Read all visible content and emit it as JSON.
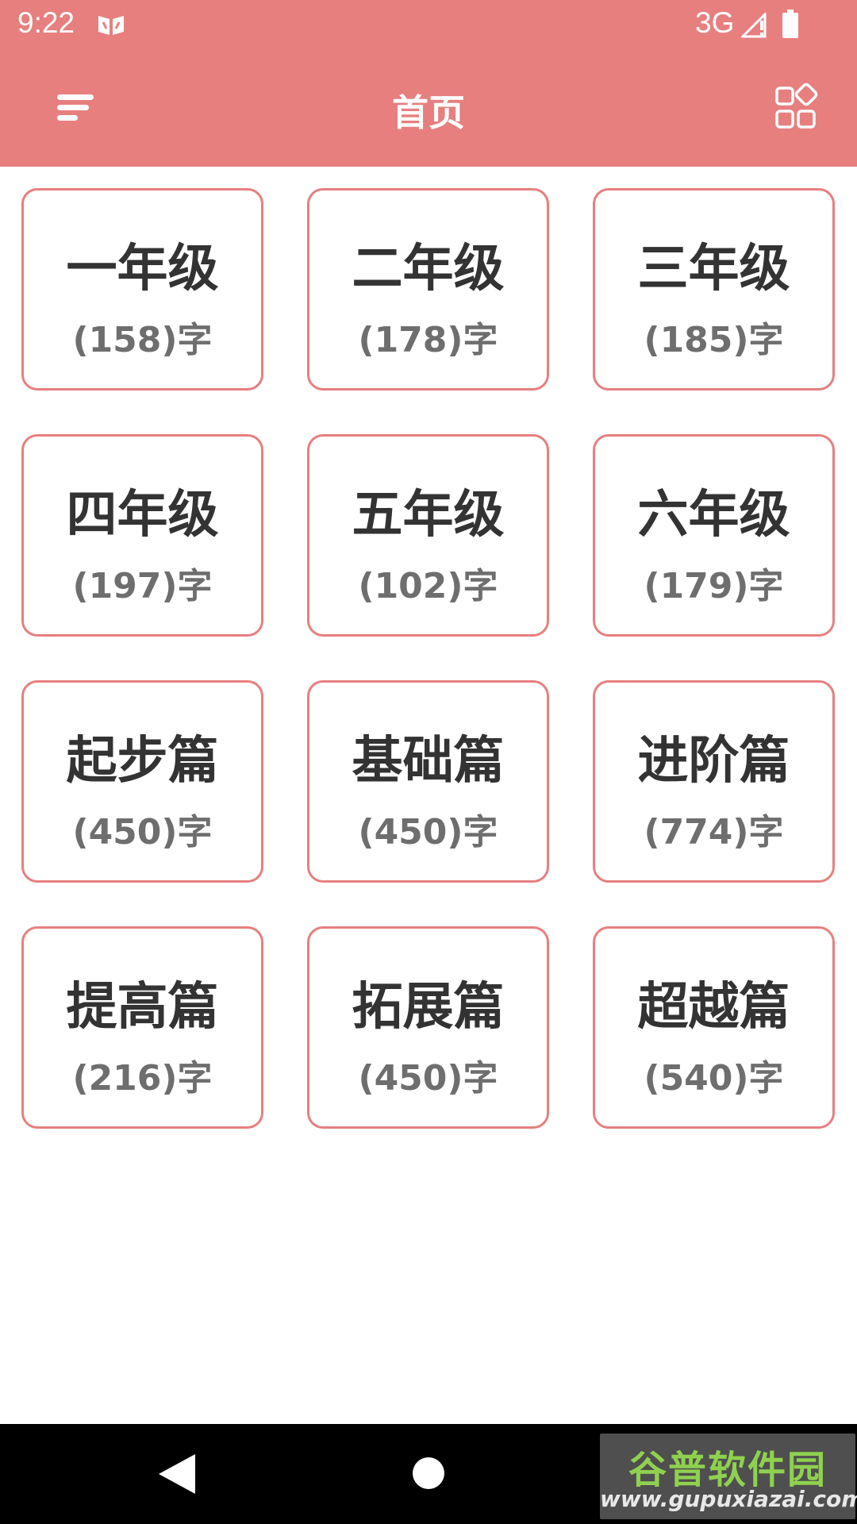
{
  "status_bar": {
    "time": "9:22",
    "network": "3G"
  },
  "header": {
    "title": "首页"
  },
  "grades": [
    {
      "title": "一年级",
      "count": "(158)字"
    },
    {
      "title": "二年级",
      "count": "(178)字"
    },
    {
      "title": "三年级",
      "count": "(185)字"
    },
    {
      "title": "四年级",
      "count": "(197)字"
    },
    {
      "title": "五年级",
      "count": "(102)字"
    },
    {
      "title": "六年级",
      "count": "(179)字"
    },
    {
      "title": "起步篇",
      "count": "(450)字"
    },
    {
      "title": "基础篇",
      "count": "(450)字"
    },
    {
      "title": "进阶篇",
      "count": "(774)字"
    },
    {
      "title": "提高篇",
      "count": "(216)字"
    },
    {
      "title": "拓展篇",
      "count": "(450)字"
    },
    {
      "title": "超越篇",
      "count": "(540)字"
    }
  ],
  "watermark": {
    "logo": "谷普软件园",
    "url": "www.gupuxiazai.com"
  },
  "colors": {
    "accent": "#e77f7f",
    "title_text": "#333333",
    "count_text": "#6e6e6e",
    "nav_bar": "#000000"
  },
  "icons": {
    "menu": "menu-sort-icon",
    "grid": "grid-layout-icon",
    "back": "back-triangle-icon",
    "home": "home-circle-icon"
  }
}
